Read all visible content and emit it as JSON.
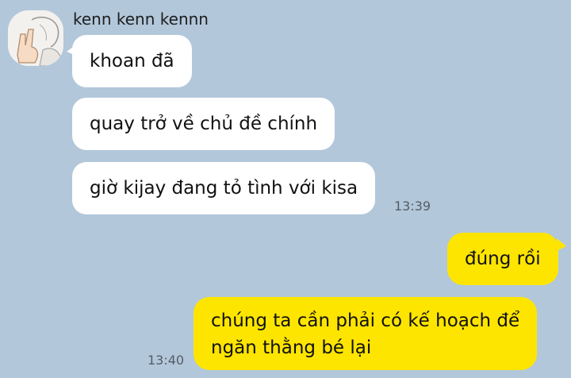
{
  "chat": {
    "sender_name": "kenn kenn kennn",
    "avatar_icon": "profile-sketch-icon",
    "colors": {
      "background": "#b2c7da",
      "incoming_bubble": "#ffffff",
      "outgoing_bubble": "#fee500"
    },
    "messages": [
      {
        "direction": "incoming",
        "text": "khoan đã"
      },
      {
        "direction": "incoming",
        "text": "quay trở về chủ đề chính"
      },
      {
        "direction": "incoming",
        "text": "giờ kijay đang tỏ tình với kisa",
        "time": "13:39"
      },
      {
        "direction": "outgoing",
        "text": "đúng rồi"
      },
      {
        "direction": "outgoing",
        "lines": [
          "chúng ta cần phải có kế hoạch để",
          "ngăn thằng bé lại"
        ],
        "time": "13:40"
      }
    ]
  }
}
